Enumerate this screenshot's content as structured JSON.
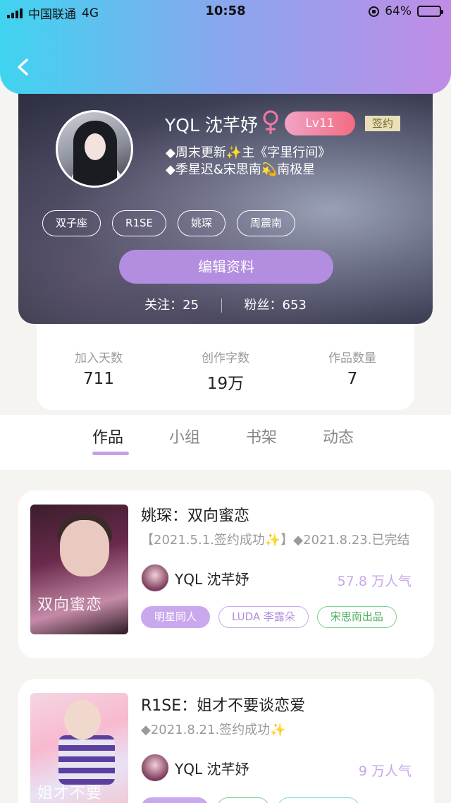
{
  "status_bar": {
    "carrier": "中国联通",
    "network": "4G",
    "time": "10:58",
    "battery": "64%",
    "battery_level": 0.64
  },
  "profile": {
    "username": "YQL 沈芊妤",
    "level": "Lv11",
    "signed_badge": "签约",
    "bio_line1": "◆周末更新✨主《字里行间》",
    "bio_line2": "◆季星迟&宋思南💫南极星",
    "tags": [
      "双子座",
      "R1SE",
      "姚琛",
      "周震南"
    ],
    "edit_button": "编辑资料",
    "following_label": "关注：",
    "following_count": "25",
    "followers_label": "粉丝：",
    "followers_count": "653"
  },
  "counts": [
    {
      "label": "加入天数",
      "value": "711"
    },
    {
      "label": "创作字数",
      "value": "19万"
    },
    {
      "label": "作品数量",
      "value": "7"
    }
  ],
  "tabs": [
    "作品",
    "小组",
    "书架",
    "动态"
  ],
  "active_tab": "作品",
  "works": [
    {
      "title": "姚琛：双向蜜恋",
      "desc": "【2021.5.1.签约成功✨】◆2021.8.23.已完结",
      "cover_text": "双向蜜恋",
      "author": "YQL 沈芊妤",
      "popularity": "57.8 万人气",
      "tags": [
        "明星同人",
        "LUDA 李露朵",
        "宋思南出品"
      ]
    },
    {
      "title": "R1SE：姐才不要谈恋爱",
      "desc": "◆2021.8.21.签约成功✨",
      "cover_text": "姐才不要",
      "author": "YQL 沈芊妤",
      "popularity": "9 万人气",
      "tags": [
        "",
        "",
        ""
      ]
    }
  ],
  "colors": {
    "accent": "#b38de0",
    "header_gradient": [
      "#3fd4f0",
      "#c08ce6"
    ],
    "level_badge": "#f36b82"
  }
}
